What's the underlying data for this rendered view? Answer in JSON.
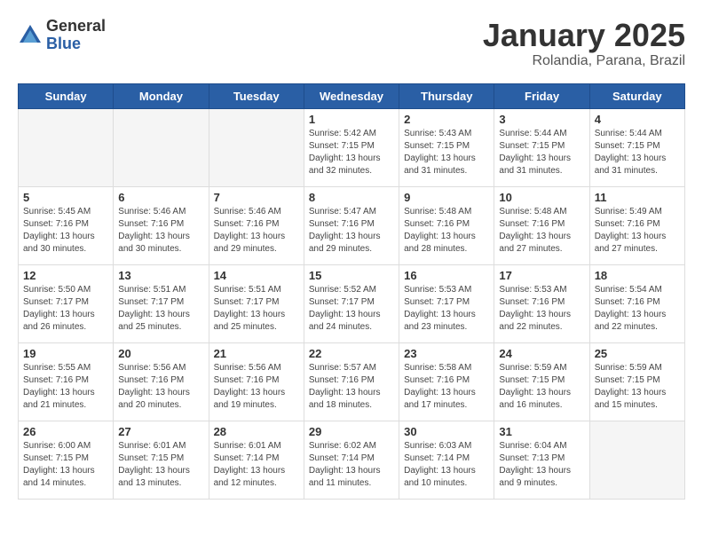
{
  "logo": {
    "general": "General",
    "blue": "Blue"
  },
  "header": {
    "month": "January 2025",
    "location": "Rolandia, Parana, Brazil"
  },
  "weekdays": [
    "Sunday",
    "Monday",
    "Tuesday",
    "Wednesday",
    "Thursday",
    "Friday",
    "Saturday"
  ],
  "weeks": [
    [
      {
        "day": "",
        "info": ""
      },
      {
        "day": "",
        "info": ""
      },
      {
        "day": "",
        "info": ""
      },
      {
        "day": "1",
        "info": "Sunrise: 5:42 AM\nSunset: 7:15 PM\nDaylight: 13 hours\nand 32 minutes."
      },
      {
        "day": "2",
        "info": "Sunrise: 5:43 AM\nSunset: 7:15 PM\nDaylight: 13 hours\nand 31 minutes."
      },
      {
        "day": "3",
        "info": "Sunrise: 5:44 AM\nSunset: 7:15 PM\nDaylight: 13 hours\nand 31 minutes."
      },
      {
        "day": "4",
        "info": "Sunrise: 5:44 AM\nSunset: 7:15 PM\nDaylight: 13 hours\nand 31 minutes."
      }
    ],
    [
      {
        "day": "5",
        "info": "Sunrise: 5:45 AM\nSunset: 7:16 PM\nDaylight: 13 hours\nand 30 minutes."
      },
      {
        "day": "6",
        "info": "Sunrise: 5:46 AM\nSunset: 7:16 PM\nDaylight: 13 hours\nand 30 minutes."
      },
      {
        "day": "7",
        "info": "Sunrise: 5:46 AM\nSunset: 7:16 PM\nDaylight: 13 hours\nand 29 minutes."
      },
      {
        "day": "8",
        "info": "Sunrise: 5:47 AM\nSunset: 7:16 PM\nDaylight: 13 hours\nand 29 minutes."
      },
      {
        "day": "9",
        "info": "Sunrise: 5:48 AM\nSunset: 7:16 PM\nDaylight: 13 hours\nand 28 minutes."
      },
      {
        "day": "10",
        "info": "Sunrise: 5:48 AM\nSunset: 7:16 PM\nDaylight: 13 hours\nand 27 minutes."
      },
      {
        "day": "11",
        "info": "Sunrise: 5:49 AM\nSunset: 7:16 PM\nDaylight: 13 hours\nand 27 minutes."
      }
    ],
    [
      {
        "day": "12",
        "info": "Sunrise: 5:50 AM\nSunset: 7:17 PM\nDaylight: 13 hours\nand 26 minutes."
      },
      {
        "day": "13",
        "info": "Sunrise: 5:51 AM\nSunset: 7:17 PM\nDaylight: 13 hours\nand 25 minutes."
      },
      {
        "day": "14",
        "info": "Sunrise: 5:51 AM\nSunset: 7:17 PM\nDaylight: 13 hours\nand 25 minutes."
      },
      {
        "day": "15",
        "info": "Sunrise: 5:52 AM\nSunset: 7:17 PM\nDaylight: 13 hours\nand 24 minutes."
      },
      {
        "day": "16",
        "info": "Sunrise: 5:53 AM\nSunset: 7:17 PM\nDaylight: 13 hours\nand 23 minutes."
      },
      {
        "day": "17",
        "info": "Sunrise: 5:53 AM\nSunset: 7:16 PM\nDaylight: 13 hours\nand 22 minutes."
      },
      {
        "day": "18",
        "info": "Sunrise: 5:54 AM\nSunset: 7:16 PM\nDaylight: 13 hours\nand 22 minutes."
      }
    ],
    [
      {
        "day": "19",
        "info": "Sunrise: 5:55 AM\nSunset: 7:16 PM\nDaylight: 13 hours\nand 21 minutes."
      },
      {
        "day": "20",
        "info": "Sunrise: 5:56 AM\nSunset: 7:16 PM\nDaylight: 13 hours\nand 20 minutes."
      },
      {
        "day": "21",
        "info": "Sunrise: 5:56 AM\nSunset: 7:16 PM\nDaylight: 13 hours\nand 19 minutes."
      },
      {
        "day": "22",
        "info": "Sunrise: 5:57 AM\nSunset: 7:16 PM\nDaylight: 13 hours\nand 18 minutes."
      },
      {
        "day": "23",
        "info": "Sunrise: 5:58 AM\nSunset: 7:16 PM\nDaylight: 13 hours\nand 17 minutes."
      },
      {
        "day": "24",
        "info": "Sunrise: 5:59 AM\nSunset: 7:15 PM\nDaylight: 13 hours\nand 16 minutes."
      },
      {
        "day": "25",
        "info": "Sunrise: 5:59 AM\nSunset: 7:15 PM\nDaylight: 13 hours\nand 15 minutes."
      }
    ],
    [
      {
        "day": "26",
        "info": "Sunrise: 6:00 AM\nSunset: 7:15 PM\nDaylight: 13 hours\nand 14 minutes."
      },
      {
        "day": "27",
        "info": "Sunrise: 6:01 AM\nSunset: 7:15 PM\nDaylight: 13 hours\nand 13 minutes."
      },
      {
        "day": "28",
        "info": "Sunrise: 6:01 AM\nSunset: 7:14 PM\nDaylight: 13 hours\nand 12 minutes."
      },
      {
        "day": "29",
        "info": "Sunrise: 6:02 AM\nSunset: 7:14 PM\nDaylight: 13 hours\nand 11 minutes."
      },
      {
        "day": "30",
        "info": "Sunrise: 6:03 AM\nSunset: 7:14 PM\nDaylight: 13 hours\nand 10 minutes."
      },
      {
        "day": "31",
        "info": "Sunrise: 6:04 AM\nSunset: 7:13 PM\nDaylight: 13 hours\nand 9 minutes."
      },
      {
        "day": "",
        "info": ""
      }
    ]
  ]
}
